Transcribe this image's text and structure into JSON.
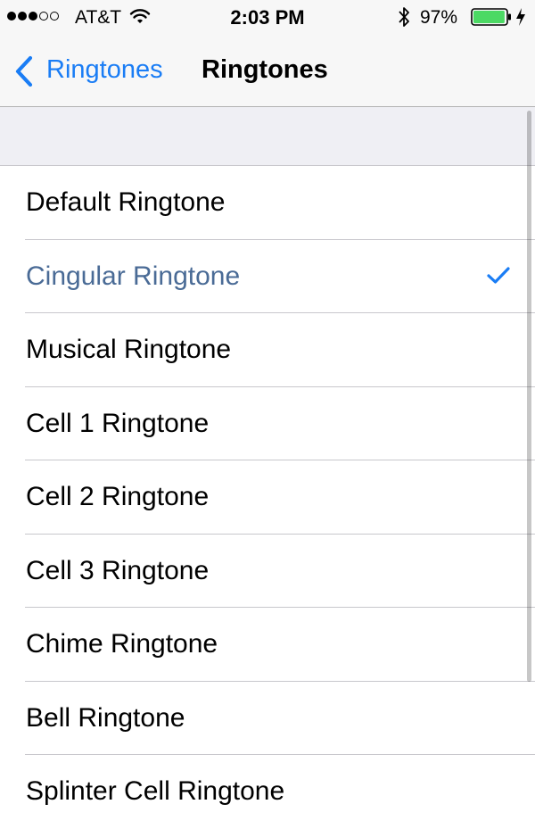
{
  "status_bar": {
    "carrier": "AT&T",
    "time": "2:03 PM",
    "battery_percent": "97%",
    "signal_bars_filled": 3,
    "signal_bars_total": 5,
    "battery_level": 0.97,
    "icons": [
      "wifi-icon",
      "bluetooth-icon",
      "battery-icon",
      "charging-icon"
    ]
  },
  "nav": {
    "back_label": "Ringtones",
    "title": "Ringtones",
    "back_icon": "chevron-left-icon"
  },
  "ringtones": {
    "items": [
      {
        "label": "Default Ringtone",
        "selected": false
      },
      {
        "label": "Cingular Ringtone",
        "selected": true
      },
      {
        "label": "Musical Ringtone",
        "selected": false
      },
      {
        "label": "Cell 1 Ringtone",
        "selected": false
      },
      {
        "label": "Cell 2 Ringtone",
        "selected": false
      },
      {
        "label": "Cell 3 Ringtone",
        "selected": false
      },
      {
        "label": "Chime Ringtone",
        "selected": false
      },
      {
        "label": "Bell Ringtone",
        "selected": false
      },
      {
        "label": "Splinter Cell Ringtone",
        "selected": false
      }
    ],
    "check_icon": "checkmark-icon"
  },
  "colors": {
    "accent": "#1a7df5",
    "selected_text": "#4a6b96",
    "battery": "#4cd964",
    "bar_background": "#f7f7f7",
    "section_background": "#efeff4",
    "separator": "#c8c7cc"
  }
}
